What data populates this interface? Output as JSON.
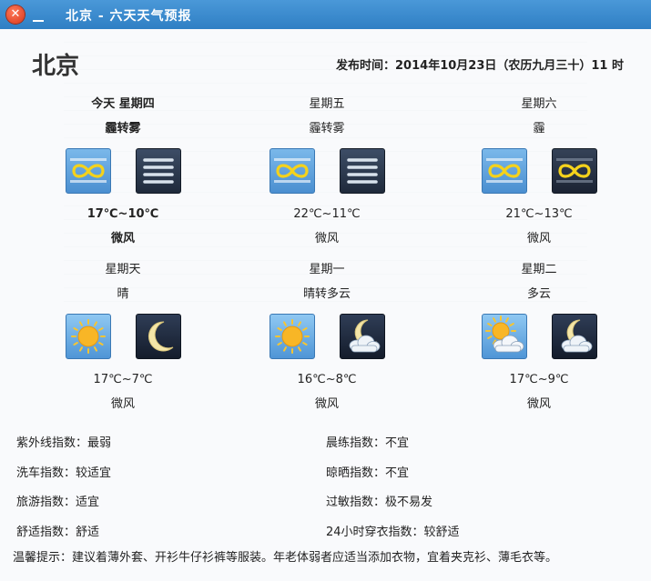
{
  "window": {
    "title": "北京 - 六天天气预报",
    "close_glyph": "✕",
    "city": "北京",
    "publish_time": "发布时间：2014年10月23日（农历九月三十）11 时"
  },
  "days": [
    {
      "name": "今天  星期四",
      "cond": "霾转雾",
      "temp": "17℃~10℃",
      "wind": "微风",
      "icons": [
        "haze-day-icon",
        "fog-icon"
      ]
    },
    {
      "name": "星期五",
      "cond": "霾转雾",
      "temp": "22℃~11℃",
      "wind": "微风",
      "icons": [
        "haze-day-icon",
        "fog-icon"
      ]
    },
    {
      "name": "星期六",
      "cond": "霾",
      "temp": "21℃~13℃",
      "wind": "微风",
      "icons": [
        "haze-day-icon",
        "haze-night-icon"
      ]
    },
    {
      "name": "星期天",
      "cond": "晴",
      "temp": "17℃~7℃",
      "wind": "微风",
      "icons": [
        "sun-icon",
        "moon-icon"
      ]
    },
    {
      "name": "星期一",
      "cond": "晴转多云",
      "temp": "16℃~8℃",
      "wind": "微风",
      "icons": [
        "sun-icon",
        "moon-cloud-icon"
      ]
    },
    {
      "name": "星期二",
      "cond": "多云",
      "temp": "17℃~9℃",
      "wind": "微风",
      "icons": [
        "sun-cloud-icon",
        "moon-cloud-icon"
      ]
    }
  ],
  "indices": {
    "uv": "紫外线指数：最弱",
    "morning_exercise": "晨练指数：不宜",
    "car_wash": "洗车指数：较适宜",
    "drying": "晾晒指数：不宜",
    "travel": "旅游指数：适宜",
    "allergy": "过敏指数：极不易发",
    "comfort": "舒适指数：舒适",
    "dressing": "24小时穿衣指数：较舒适"
  },
  "tip": "温馨提示：建议着薄外套、开衫牛仔衫裤等服装。年老体弱者应适当添加衣物，宜着夹克衫、薄毛衣等。"
}
